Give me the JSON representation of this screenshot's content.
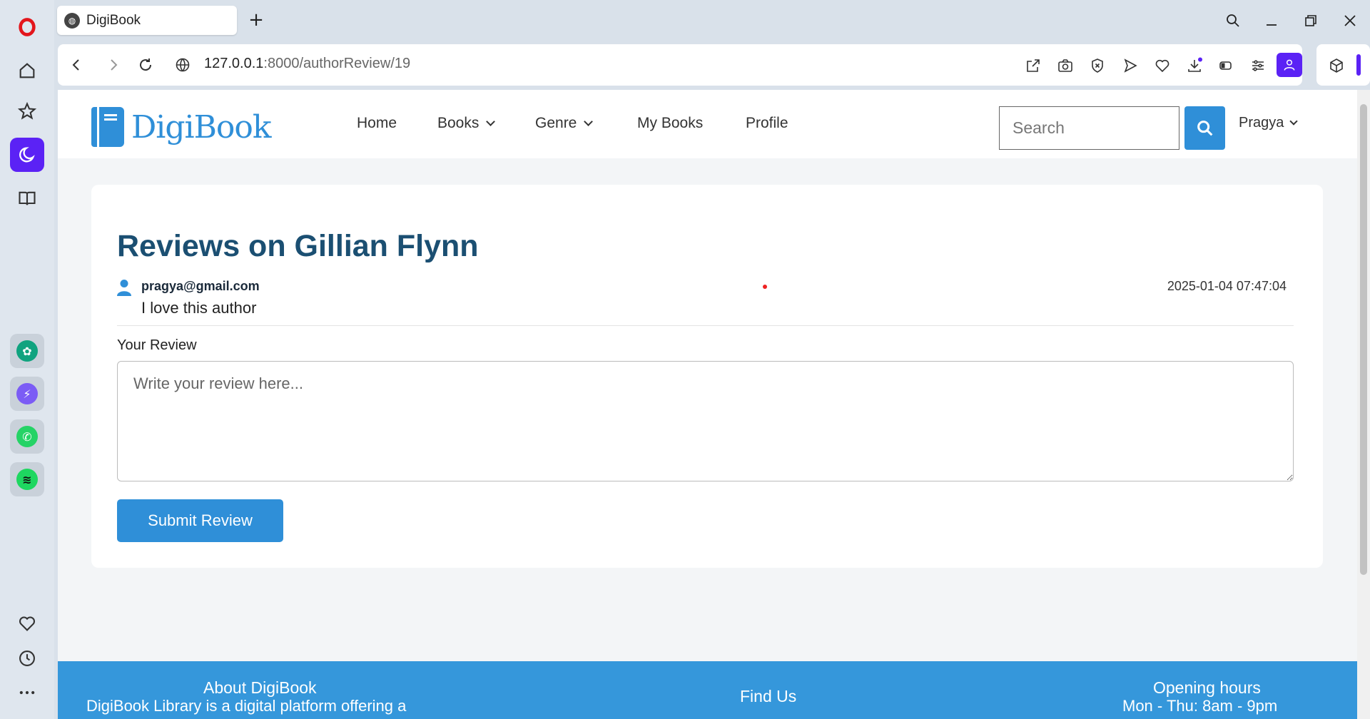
{
  "browser": {
    "tab_title": "DigiBook",
    "new_tab_label": "+",
    "url_host": "127.0.0.1",
    "url_path": ":8000/authorReview/19"
  },
  "site": {
    "logo_text": "DigiBook",
    "nav": {
      "home": "Home",
      "books": "Books",
      "genre": "Genre",
      "my_books": "My Books",
      "profile": "Profile"
    },
    "search_placeholder": "Search",
    "user_name": "Pragya"
  },
  "page": {
    "title": "Reviews on Gillian Flynn",
    "reviews": [
      {
        "user": "pragya@gmail.com",
        "timestamp": "2025-01-04 07:47:04",
        "text": "I love this author"
      }
    ],
    "your_review_label": "Your Review",
    "textarea_placeholder": "Write your review here...",
    "submit_label": "Submit Review"
  },
  "footer": {
    "about_title": "About DigiBook",
    "about_text": "DigiBook Library is a digital platform offering a",
    "find_title": "Find Us",
    "hours_title": "Opening hours",
    "hours_text": "Mon - Thu: 8am - 9pm"
  },
  "colors": {
    "accent": "#2f8fd8",
    "heading": "#1b4f72",
    "footer_bg": "#3597db",
    "opera_active": "#5b22f5"
  }
}
